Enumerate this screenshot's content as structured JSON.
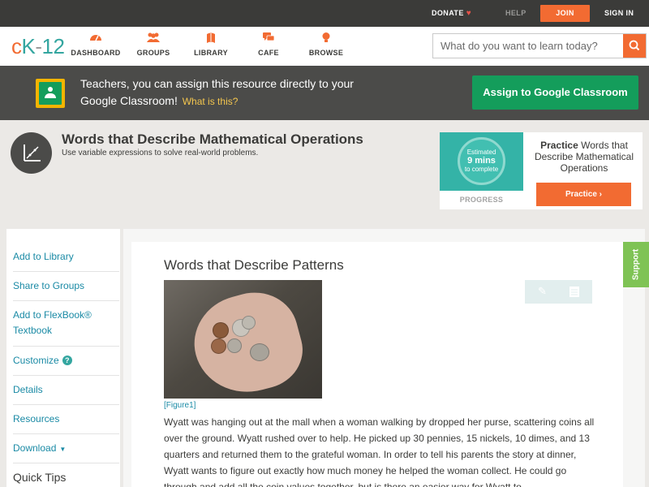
{
  "topbar": {
    "donate": "DONATE",
    "help": "HELP",
    "join": "JOIN",
    "sign_in": "SIGN IN"
  },
  "logo": {
    "part1": "c",
    "part2": "K",
    "part3": "-",
    "part4": "12"
  },
  "nav": {
    "items": [
      {
        "label": "DASHBOARD",
        "icon": "dashboard-icon"
      },
      {
        "label": "GROUPS",
        "icon": "groups-icon"
      },
      {
        "label": "LIBRARY",
        "icon": "library-icon"
      },
      {
        "label": "CAFE",
        "icon": "cafe-icon"
      },
      {
        "label": "BROWSE",
        "icon": "browse-icon"
      }
    ],
    "search_placeholder": "What do you want to learn today?"
  },
  "banner": {
    "text": "Teachers, you can assign this resource directly to your Google Classroom!",
    "what_is_this": "What is this?",
    "assign_button": "Assign to Google Classroom"
  },
  "concept": {
    "title": "Words that Describe Mathematical Operations",
    "subtitle": "Use variable expressions to solve real-world problems."
  },
  "practice_card": {
    "estimated_line1": "Estimated",
    "estimated_mins": "9 mins",
    "estimated_line3": "to complete",
    "progress_label": "PROGRESS",
    "title_bold": "Practice",
    "title_rest": "Words that Describe Mathematical Operations",
    "button": "Practice"
  },
  "sidebar": {
    "items": [
      {
        "label": "Add to Library"
      },
      {
        "label": "Share to Groups"
      },
      {
        "label": "Add to FlexBook® Textbook"
      },
      {
        "label": "Customize"
      },
      {
        "label": "Details"
      },
      {
        "label": "Resources"
      },
      {
        "label": "Download"
      }
    ],
    "quick_tips": "Quick Tips"
  },
  "article": {
    "title": "Words that Describe Patterns",
    "figure_label": "[Figure1]",
    "body": "Wyatt was hanging out at the mall when a woman walking by dropped her purse, scattering coins all over the ground. Wyatt rushed over to help. He picked up 30 pennies, 15 nickels, 10 dimes, and 13 quarters and returned them to the grateful woman. In order to tell his parents the story at dinner, Wyatt wants to figure out exactly how much money he helped the woman collect. He could go through and add all the coin values together, but is there an easier way for Wyatt to"
  },
  "support_tab": "Support",
  "colors": {
    "brand_orange": "#f26b32",
    "brand_teal": "#34a6a0",
    "google_green": "#149d5b",
    "support_green": "#7fc355",
    "link_blue": "#1a8aa5"
  }
}
